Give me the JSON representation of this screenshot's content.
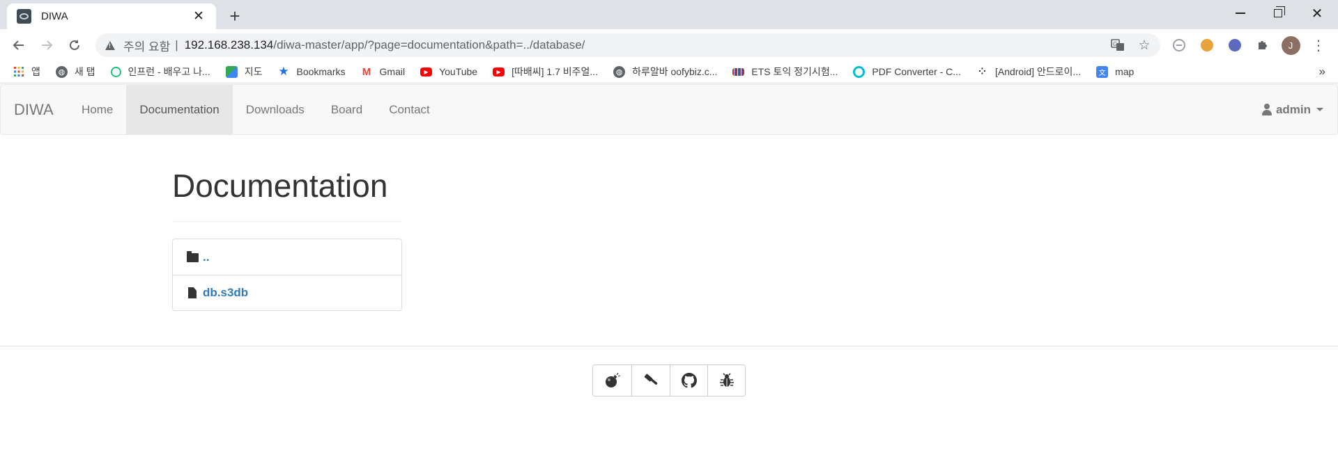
{
  "browser": {
    "tab_title": "DIWA",
    "url_warning": "주의 요함",
    "url_separator": "|",
    "url_host": "192.168.238.134",
    "url_path": "/diwa-master/app/?page=documentation&path=../database/",
    "avatar_letter": "J"
  },
  "bookmarks": [
    {
      "label": "앱",
      "icon": "apps-grid-icon"
    },
    {
      "label": "새 탭",
      "icon": "globe-icon"
    },
    {
      "label": "인프런 - 배우고 나...",
      "icon": "inflearn-icon"
    },
    {
      "label": "지도",
      "icon": "maps-icon"
    },
    {
      "label": "Bookmarks",
      "icon": "star-icon"
    },
    {
      "label": "Gmail",
      "icon": "gmail-icon"
    },
    {
      "label": "YouTube",
      "icon": "youtube-icon"
    },
    {
      "label": "[따배씨] 1.7 비주얼...",
      "icon": "youtube-icon"
    },
    {
      "label": "하루알바 oofybiz.c...",
      "icon": "globe-icon"
    },
    {
      "label": "ETS 토익 정기시험...",
      "icon": "ets-icon"
    },
    {
      "label": "PDF Converter - C...",
      "icon": "pdf-converter-icon"
    },
    {
      "label": "[Android] 안드로이...",
      "icon": "tistory-icon"
    },
    {
      "label": "map",
      "icon": "translate-map-icon"
    }
  ],
  "bookmarks_more": "»",
  "navbar": {
    "brand": "DIWA",
    "links": [
      "Home",
      "Documentation",
      "Downloads",
      "Board",
      "Contact"
    ],
    "active_index": 1,
    "user": "admin"
  },
  "page": {
    "title": "Documentation",
    "entries": [
      {
        "type": "folder",
        "name": ".."
      },
      {
        "type": "file",
        "name": "db.s3db"
      }
    ]
  },
  "footer": {
    "buttons": [
      "bomb-icon",
      "gavel-icon",
      "github-icon",
      "bug-icon"
    ]
  },
  "colors": {
    "link": "#337ab7",
    "navbar_bg": "#f8f8f8",
    "active_nav_bg": "#e7e7e7",
    "tabstrip_bg": "#dee1e6"
  }
}
